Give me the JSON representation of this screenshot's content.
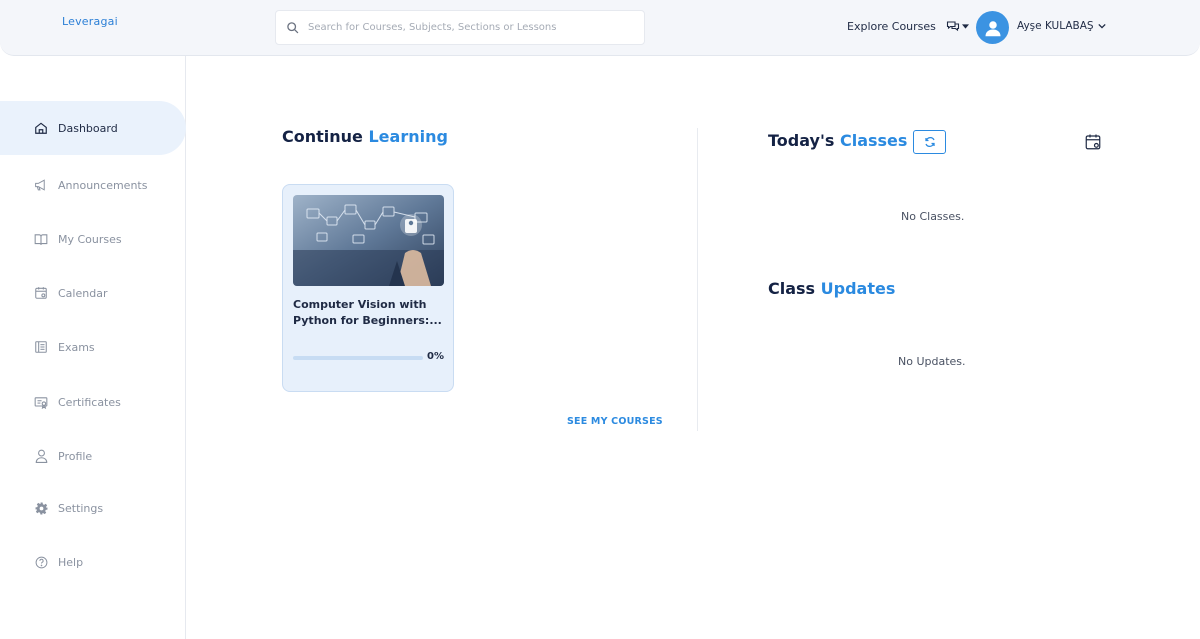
{
  "header": {
    "logo": "Leveragai",
    "search_placeholder": "Search for Courses, Subjects, Sections or Lessons",
    "explore": "Explore Courses",
    "user_name": "Ayşe KULABAŞ"
  },
  "sidebar": {
    "items": [
      {
        "label": "Dashboard",
        "icon": "home-icon",
        "active": true
      },
      {
        "label": "Announcements",
        "icon": "megaphone-icon"
      },
      {
        "label": "My Courses",
        "icon": "book-icon"
      },
      {
        "label": "Calendar",
        "icon": "calendar-icon"
      },
      {
        "label": "Exams",
        "icon": "exam-icon"
      },
      {
        "label": "Certificates",
        "icon": "certificate-icon"
      },
      {
        "label": "Profile",
        "icon": "user-icon"
      },
      {
        "label": "Settings",
        "icon": "gear-icon"
      },
      {
        "label": "Help",
        "icon": "help-icon"
      }
    ]
  },
  "continue_learning": {
    "title_main": "Continue ",
    "title_accent": "Learning",
    "course": {
      "title": "Computer Vision with Python for Beginners:...",
      "progress_percent": 0,
      "progress_label": "0%"
    },
    "see_courses": "SEE MY COURSES"
  },
  "todays_classes": {
    "title_main": "Today's ",
    "title_accent": "Classes",
    "empty": "No Classes."
  },
  "class_updates": {
    "title_main": "Class ",
    "title_accent": "Updates",
    "empty": "No Updates."
  },
  "colors": {
    "accent": "#2b8ae0",
    "heading": "#142244",
    "sidebar_active_bg": "#eaf2fc"
  }
}
